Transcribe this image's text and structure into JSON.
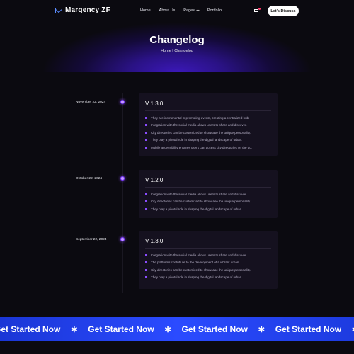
{
  "header": {
    "brand": "Marqency ZF",
    "menu": [
      "Home",
      "About Us",
      "Pages",
      "Portfolio"
    ],
    "cta_label": "Let's Discuss"
  },
  "page": {
    "title": "Changelog",
    "breadcrumb": "Home | Changelog"
  },
  "entries": [
    {
      "date": "November 22, 2024",
      "version": "V 1.3.0",
      "items": [
        "They are instrumental in promoting events, creating a centralized hub.",
        "Integration with the social media allows users to share and discover.",
        "City directories can be customized to showcase the unique personality.",
        "They play a pivotal role in shaping the digital landscape of urban.",
        "Mobile accessibility ensures users can access city directories on the go."
      ]
    },
    {
      "date": "October 22, 2024",
      "version": "V 1.2.0",
      "items": [
        "Integration with the social media allows users to share and discover.",
        "City directories can be customized to showcase the unique personality.",
        "They play a pivotal role in shaping the digital landscape of urban."
      ]
    },
    {
      "date": "September 22, 2024",
      "version": "V 1.3.0",
      "items": [
        "Integration with the social media allows users to share and discover.",
        "The platforms contribute to the development of a vibrant urban.",
        "City directories can be customized to showcase the unique personality.",
        "They play a pivotal role in shaping the digital landscape of urban."
      ]
    }
  ],
  "marquee": {
    "text": "Get Started Now",
    "separator": "∗"
  },
  "colors": {
    "accent": "#8a4dff",
    "banner": "#2b4bff",
    "background": "#0b0a10"
  }
}
